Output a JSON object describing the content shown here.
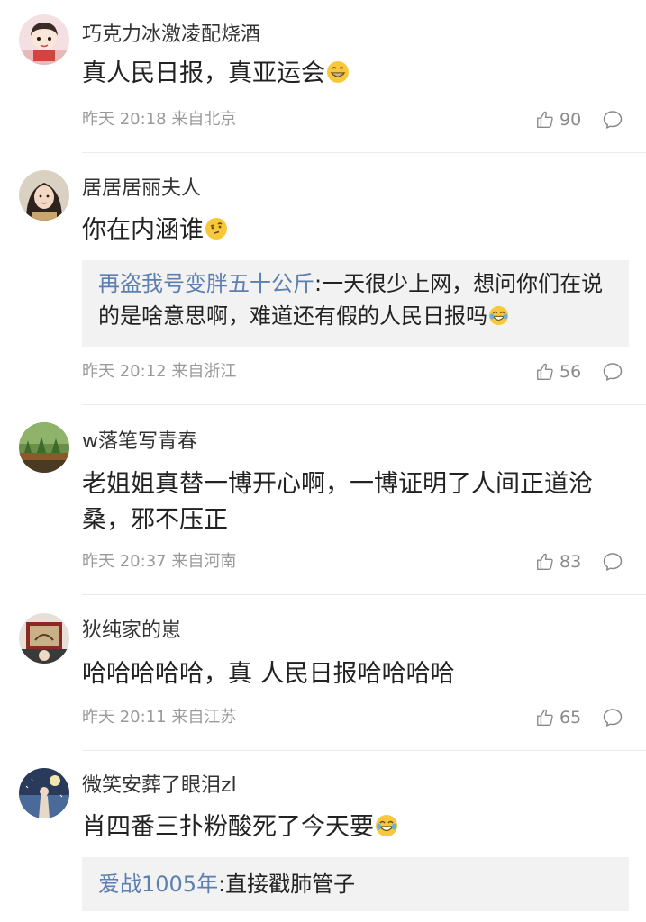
{
  "comments": [
    {
      "username": "巧克力冰激凌配烧酒",
      "text": "真人民日报，真亚运会",
      "emoji": "grin-emoji",
      "time": "昨天 20:18",
      "location": "来自北京",
      "likes": "90"
    },
    {
      "username": "居居居丽夫人",
      "text": "你在内涵谁",
      "emoji": "thinking-emoji",
      "quote_user": "再盗我号变胖五十公斤",
      "quote_text": ":一天很少上网，想问你们在说的是啥意思啊，难道还有假的人民日报吗",
      "quote_emoji": "laugh-cry-emoji",
      "time": "昨天 20:12",
      "location": "来自浙江",
      "likes": "56"
    },
    {
      "username": "w落笔写青春",
      "text": "老姐姐真替一博开心啊，一博证明了人间正道沧桑，邪不压正",
      "time": "昨天 20:37",
      "location": "来自河南",
      "likes": "83"
    },
    {
      "username": "狄纯家的崽",
      "text": "哈哈哈哈哈，真 人民日报哈哈哈哈",
      "time": "昨天 20:11",
      "location": "来自江苏",
      "likes": "65"
    },
    {
      "username": "微笑安葬了眼泪zl",
      "text": "肖四番三扑粉酸死了今天要",
      "emoji": "laugh-cry-emoji",
      "quote_user": "爱战1005年",
      "quote_text": ":直接戳肺管子"
    }
  ],
  "colors": {
    "quote_name": "#5b7fb0",
    "meta": "#9a9a9a",
    "quote_bg": "#f2f2f2"
  }
}
